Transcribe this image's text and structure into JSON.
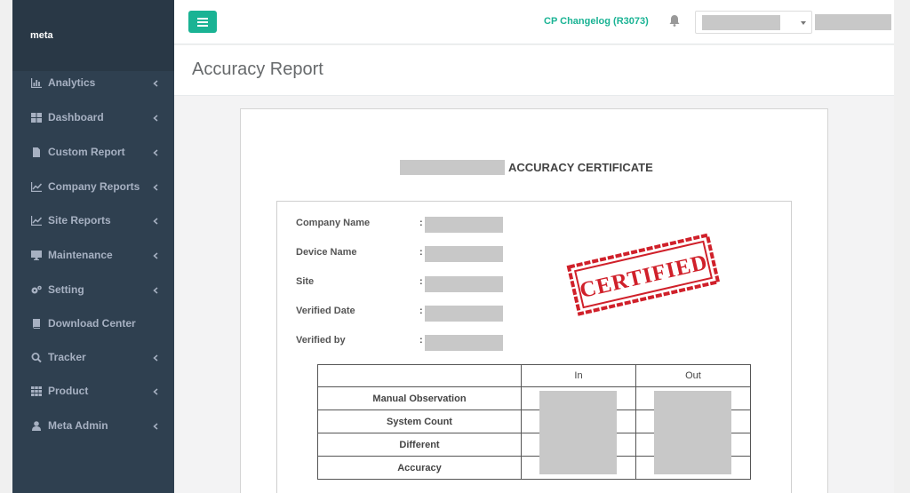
{
  "brand": {
    "name": "meta"
  },
  "sidebar": {
    "items": [
      {
        "label": "Analytics",
        "icon": "bar-chart-icon",
        "has_submenu": true
      },
      {
        "label": "Dashboard",
        "icon": "grid-icon",
        "has_submenu": true
      },
      {
        "label": "Custom Report",
        "icon": "file-icon",
        "has_submenu": true
      },
      {
        "label": "Company Reports",
        "icon": "line-chart-icon",
        "has_submenu": true
      },
      {
        "label": "Site Reports",
        "icon": "line-chart-icon",
        "has_submenu": true
      },
      {
        "label": "Maintenance",
        "icon": "desktop-icon",
        "has_submenu": true
      },
      {
        "label": "Setting",
        "icon": "gears-icon",
        "has_submenu": true
      },
      {
        "label": "Download Center",
        "icon": "book-icon",
        "has_submenu": false
      },
      {
        "label": "Tracker",
        "icon": "search-icon",
        "has_submenu": true
      },
      {
        "label": "Product",
        "icon": "table-icon",
        "has_submenu": true
      },
      {
        "label": "Meta Admin",
        "icon": "user-icon",
        "has_submenu": true
      }
    ]
  },
  "topbar": {
    "changelog_label": "CP Changelog (R3073)",
    "menu_icon": "bars-icon",
    "notification_icon": "bell-icon"
  },
  "page": {
    "title": "Accuracy Report"
  },
  "certificate": {
    "title": "ACCURACY CERTIFICATE",
    "stamp_text": "CERTIFIED",
    "fields": [
      {
        "label": "Company Name",
        "separator": ":"
      },
      {
        "label": "Device Name",
        "separator": ":"
      },
      {
        "label": "Site",
        "separator": ":"
      },
      {
        "label": "Verified Date",
        "separator": ":"
      },
      {
        "label": "Verified by",
        "separator": ":"
      }
    ],
    "table": {
      "columns": [
        "",
        "In",
        "Out"
      ],
      "rows": [
        "Manual Observation",
        "System Count",
        "Different",
        "Accuracy"
      ]
    }
  },
  "colors": {
    "accent": "#1ab394",
    "sidebar_bg": "#2f4050",
    "stamp": "#d0202a"
  }
}
